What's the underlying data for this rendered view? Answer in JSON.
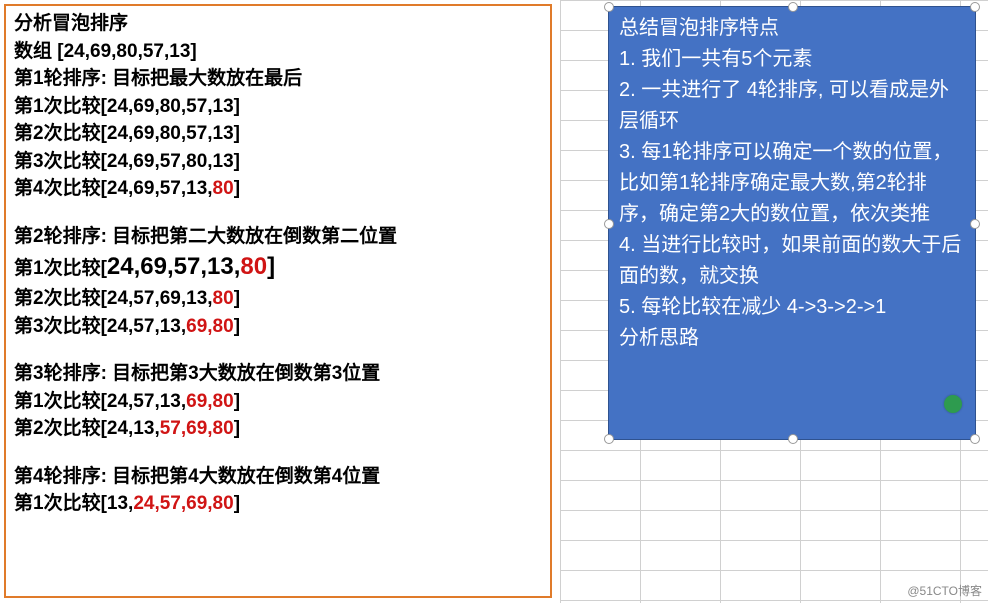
{
  "left": {
    "title": "分析冒泡排序",
    "array_label": "数组 [24,69,80,57,13]",
    "round1": {
      "header": "第1轮排序: 目标把最大数放在最后",
      "c1_prefix": "第1次比较[24,69,80,57,13]",
      "c2_prefix": "第2次比较[24,69,80,57,13]",
      "c3_prefix": "第3次比较[24,69,57,80,13]",
      "c4_prefix": "第4次比较[24,69,57,13,",
      "c4_red": "80",
      "c4_suffix": "]"
    },
    "round2": {
      "header": "第2轮排序: 目标把第二大数放在倒数第二位置",
      "c1_prefix": "第1次比较[",
      "c1_big": "24,69,57,13,",
      "c1_big_red": "80",
      "c1_suffix": "]",
      "c2_prefix": "第2次比较[24,57,69,13,",
      "c2_red": "80",
      "c2_suffix": "]",
      "c3_prefix": "第3次比较[24,57,13,",
      "c3_red": "69,80",
      "c3_suffix": "]"
    },
    "round3": {
      "header": "第3轮排序: 目标把第3大数放在倒数第3位置",
      "c1_prefix": "第1次比较[24,57,13,",
      "c1_red": "69,80",
      "c1_suffix": "]",
      "c2_prefix": "第2次比较[24,13,",
      "c2_red": "57,69,80",
      "c2_suffix": "]"
    },
    "round4": {
      "header": "第4轮排序: 目标把第4大数放在倒数第4位置",
      "c1_prefix": "第1次比较[13,",
      "c1_red": "24,57,69,80",
      "c1_suffix": "]"
    }
  },
  "right": {
    "title": "总结冒泡排序特点",
    "p1": "1. 我们一共有5个元素",
    "p2": "2. 一共进行了 4轮排序, 可以看成是外层循环",
    "p3": "3. 每1轮排序可以确定一个数的位置，比如第1轮排序确定最大数,第2轮排序，确定第2大的数位置，依次类推",
    "p4": "4. 当进行比较时，如果前面的数大于后面的数，就交换",
    "p5a": "5. 每轮比较在减少 4->3->2->1",
    "p5b": "分析思路"
  },
  "watermark": "@51CTO博客"
}
